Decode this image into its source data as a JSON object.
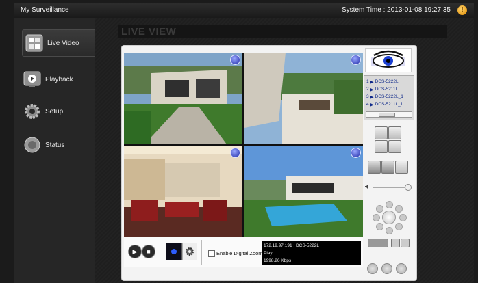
{
  "app_title": "My Surveillance",
  "system_time": "System Time : 2013-01-08 19:27:35",
  "alert_glyph": "!",
  "sidebar": {
    "items": [
      {
        "label": "Live Video",
        "icon": "live-video-icon"
      },
      {
        "label": "Playback",
        "icon": "playback-icon"
      },
      {
        "label": "Setup",
        "icon": "gear-icon"
      },
      {
        "label": "Status",
        "icon": "status-icon"
      }
    ]
  },
  "main": {
    "title": "LIVE VIEW"
  },
  "camera_list": [
    {
      "index": "1",
      "name": "DCS-5222L"
    },
    {
      "index": "2",
      "name": "DCS-5211L"
    },
    {
      "index": "3",
      "name": "DCS-5222L_1"
    },
    {
      "index": "4",
      "name": "DCS-5211L_1"
    }
  ],
  "scroll_glyph": "|||",
  "controls": {
    "digital_zoom_label": "Enable Digital Zoom",
    "info": {
      "address": "172.19.97.191 : DCS-5222L",
      "status": "Play",
      "bitrate": "1998.26 Kbps"
    }
  },
  "colors": {
    "accent_blue": "#1e2aa6",
    "topbar": "#1f1f1f",
    "panel": "#f3f3f3"
  }
}
